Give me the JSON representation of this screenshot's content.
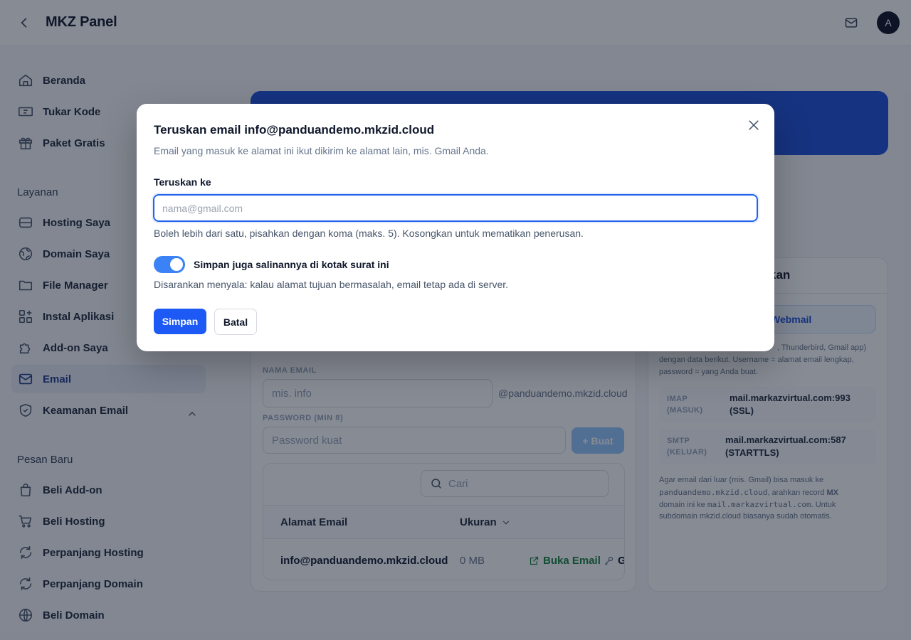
{
  "app": {
    "title": "MKZ Panel",
    "avatar_initial": "A"
  },
  "sidebar": {
    "top_items": [
      {
        "label": "Beranda",
        "icon": "home-icon"
      },
      {
        "label": "Tukar Kode",
        "icon": "ticket-icon"
      },
      {
        "label": "Paket Gratis",
        "icon": "gift-icon"
      }
    ],
    "services_title": "Layanan",
    "services": [
      {
        "label": "Hosting Saya",
        "icon": "server-icon"
      },
      {
        "label": "Domain Saya",
        "icon": "globe-icon"
      },
      {
        "label": "File Manager",
        "icon": "folder-icon"
      },
      {
        "label": "Instal Aplikasi",
        "icon": "apps-icon"
      },
      {
        "label": "Add-on Saya",
        "icon": "puzzle-icon"
      },
      {
        "label": "Email",
        "icon": "mail-icon",
        "active": true
      },
      {
        "label": "Keamanan Email",
        "icon": "shield-icon"
      }
    ],
    "orders_title": "Pesan Baru",
    "orders": [
      {
        "label": "Beli Add-on",
        "icon": "bag-icon"
      },
      {
        "label": "Beli Hosting",
        "icon": "cart-icon"
      },
      {
        "label": "Perpanjang Hosting",
        "icon": "refresh-icon"
      },
      {
        "label": "Perpanjang Domain",
        "icon": "refresh-icon"
      },
      {
        "label": "Beli Domain",
        "icon": "globe-icon"
      }
    ]
  },
  "create_form": {
    "name_label": "NAMA EMAIL",
    "name_placeholder": "mis. info",
    "domain_suffix": "@panduandemo.mkzid.cloud",
    "password_label": "PASSWORD (MIN 8)",
    "password_placeholder": "Password kuat",
    "create_button": "+ Buat"
  },
  "table": {
    "search_placeholder": "Cari",
    "columns": [
      "Alamat Email",
      "Ukuran"
    ],
    "rows": [
      {
        "email": "info@panduandemo.mkzid.cloud",
        "size": "0 MB",
        "open_label": "Buka Email",
        "extra_label": "G"
      }
    ]
  },
  "right_panel": {
    "title_fragment": "kan",
    "webmail_fragment": "Webmail",
    "desc_line1": ", Thunderbird, Gmail app)",
    "desc_line2": "dengan data berikut. Username = alamat email lengkap,",
    "desc_line3": "password = yang Anda buat.",
    "imap_key_1": "IMAP",
    "imap_key_2": "(MASUK)",
    "imap_val_1": "mail.markazvirtual.com:993",
    "imap_val_2": "(SSL)",
    "smtp_key_1": "SMTP",
    "smtp_key_2": "(KELUAR)",
    "smtp_val_1": "mail.markazvirtual.com:587",
    "smtp_val_2": "(STARTTLS)",
    "mx_l1": "Agar email dari luar (mis. Gmail) bisa masuk ke",
    "mx_l2_domain": "panduandemo.mkzid.cloud",
    "mx_l2_mid": ", arahkan record ",
    "mx_l2_mx": "MX",
    "mx_l3_a": "domain ini ke ",
    "mx_l3_host": "mail.markazvirtual.com",
    "mx_l3_b": ". Untuk",
    "mx_l4": "subdomain mkzid.cloud biasanya sudah otomatis."
  },
  "modal": {
    "title": "Teruskan email info@panduandemo.mkzid.cloud",
    "subtitle": "Email yang masuk ke alamat ini ikut dikirim ke alamat lain, mis. Gmail Anda.",
    "field_label": "Teruskan ke",
    "field_placeholder": "nama@gmail.com",
    "field_value": "",
    "field_help": "Boleh lebih dari satu, pisahkan dengan koma (maks. 5). Kosongkan untuk mematikan penerusan.",
    "toggle_label": "Simpan juga salinannya di kotak surat ini",
    "toggle_on": true,
    "toggle_help": "Disarankan menyala: kalau alamat tujuan bermasalah, email tetap ada di server.",
    "save_button": "Simpan",
    "cancel_button": "Batal"
  },
  "colors": {
    "accent": "#1d5af5",
    "banner": "#1d4ed8",
    "toggle_on": "#3b82f6",
    "success": "#15803d"
  }
}
